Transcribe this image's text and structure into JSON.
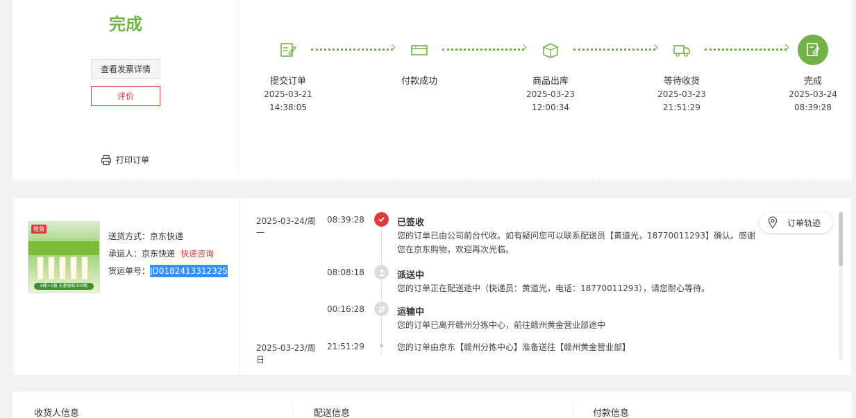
{
  "status": {
    "title": "完成",
    "invoice_button": "查看发票详情",
    "review_button": "评价",
    "print_label": "打印订单"
  },
  "steps": [
    {
      "name": "提交订单",
      "date": "2025-03-21",
      "time": "14:38:05",
      "icon": "edit-order-icon"
    },
    {
      "name": "付款成功",
      "date": "",
      "time": "",
      "icon": "payment-icon"
    },
    {
      "name": "商品出库",
      "date": "2025-03-23",
      "time": "12:00:34",
      "icon": "package-icon"
    },
    {
      "name": "等待收货",
      "date": "2025-03-23",
      "time": "21:51:29",
      "icon": "truck-icon"
    },
    {
      "name": "完成",
      "date": "2025-03-24",
      "time": "08:39:28",
      "icon": "done-icon"
    }
  ],
  "product": {
    "brand": "榄菊",
    "shipping_method": "送货方式：京东快递",
    "carrier_label": "承运人：京东快递",
    "carrier_consult": "快递咨询",
    "tracking_label": "货运单号：",
    "tracking_number": "JD0182413312325",
    "image_caption": "6瓶+1器 无香驱蚊300晚"
  },
  "tracking": {
    "button_label": "订单轨迹",
    "events": [
      {
        "date": "2025-03-24/周一",
        "time": "08:39:28",
        "title": "已签收",
        "text": "您的订单已由公司前台代收。如有疑问您可以联系配送员【黄道光，18770011293】确认。感谢您在京东购物，欢迎再次光临。"
      },
      {
        "date": "",
        "time": "08:08:18",
        "title": "派送中",
        "text": "您的订单正在配送途中（快递员：黄道光，电话：18770011293），请您耐心等待。"
      },
      {
        "date": "",
        "time": "00:16:28",
        "title": "运输中",
        "text": "您的订单已离开赣州分拣中心，前往赣州黄金营业部途中"
      },
      {
        "date": "2025-03-23/周日",
        "time": "21:51:29",
        "title": "",
        "text": "您的订单由京东【赣州分拣中心】准备送往【赣州黄金营业部】"
      }
    ]
  },
  "info": {
    "receiver": "收货人信息",
    "delivery": "配送信息",
    "payment": "付款信息"
  },
  "colors": {
    "accent_green": "#71b247",
    "accent_red": "#e4393c",
    "highlight_blue": "#3390ff"
  }
}
